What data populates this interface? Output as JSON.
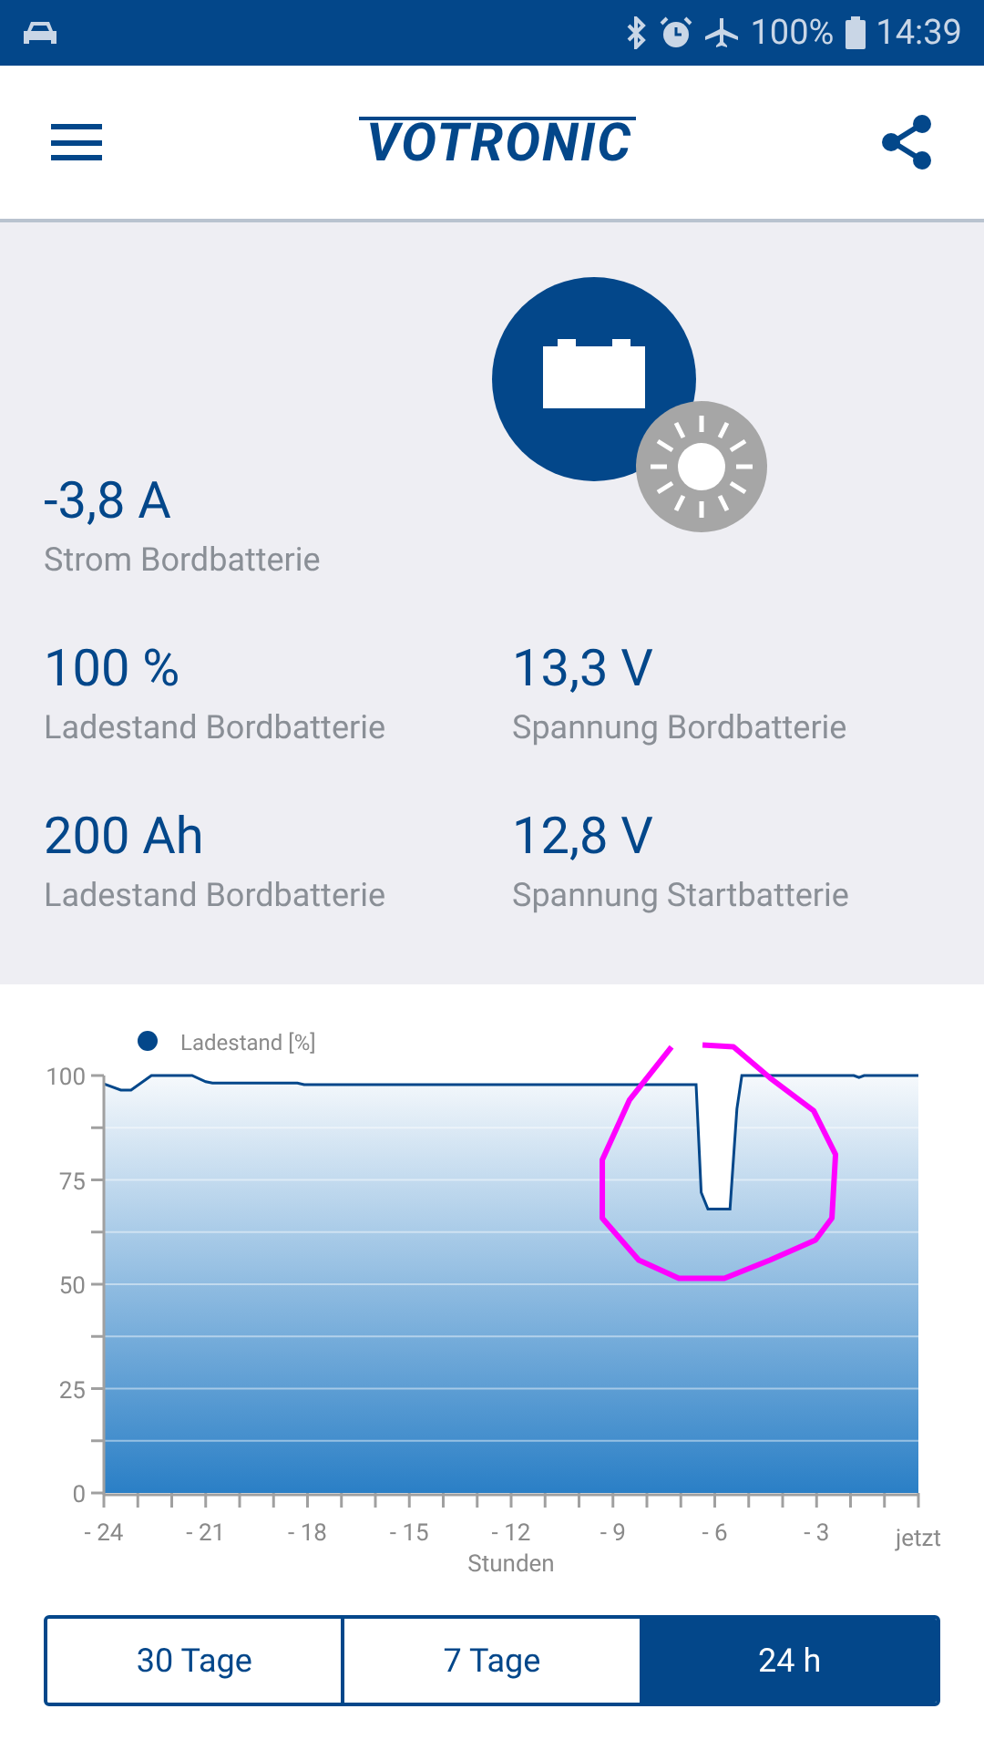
{
  "status_bar": {
    "battery": "100%",
    "time": "14:39"
  },
  "header": {
    "logo": "VOTRONIC"
  },
  "readings": [
    {
      "value": "-3,8 A",
      "label": "Strom Bordbatterie"
    },
    {
      "value": "100 %",
      "label": "Ladestand Bordbatterie"
    },
    {
      "value": "13,3 V",
      "label": "Spannung Bordbatterie"
    },
    {
      "value": "200 Ah",
      "label": "Ladestand Bordbatterie"
    },
    {
      "value": "12,8 V",
      "label": "Spannung Startbatterie"
    }
  ],
  "chart": {
    "chart_data": {
      "type": "line",
      "xlabel": "Stunden",
      "x": [
        -24,
        -23.5,
        -23.2,
        -22.6,
        -21.4,
        -21.0,
        -20.8,
        -18.3,
        -18.1,
        -6.55,
        -6.4,
        -6.2,
        -5.55,
        -5.35,
        -5.2,
        -1.9,
        -1.75,
        -1.6,
        0
      ],
      "series": [
        {
          "name": "Ladestand [%]",
          "color": "#03478a",
          "values": [
            98,
            96.5,
            96.5,
            100,
            100,
            98.5,
            98.2,
            98.2,
            97.8,
            97.8,
            72,
            68,
            68,
            92,
            100,
            100,
            99.5,
            100,
            100
          ]
        }
      ],
      "xlim": [
        -24,
        0
      ],
      "ylim": [
        0,
        100
      ],
      "xticks": [
        {
          "value": -24,
          "label": "- 24"
        },
        {
          "value": -21,
          "label": "- 21"
        },
        {
          "value": -18,
          "label": "- 18"
        },
        {
          "value": -15,
          "label": "- 15"
        },
        {
          "value": -12,
          "label": "- 12"
        },
        {
          "value": -9,
          "label": "- 9"
        },
        {
          "value": -6,
          "label": "- 6"
        },
        {
          "value": -3,
          "label": "- 3"
        },
        {
          "value": 0,
          "label": "jetzt"
        }
      ],
      "yticks": [
        0,
        25,
        50,
        75,
        100
      ],
      "grid": true
    },
    "markup": {
      "kind": "circle"
    }
  },
  "range_tabs": [
    {
      "label": "30 Tage",
      "selected": false
    },
    {
      "label": "7 Tage",
      "selected": false
    },
    {
      "label": "24 h",
      "selected": true
    }
  ]
}
